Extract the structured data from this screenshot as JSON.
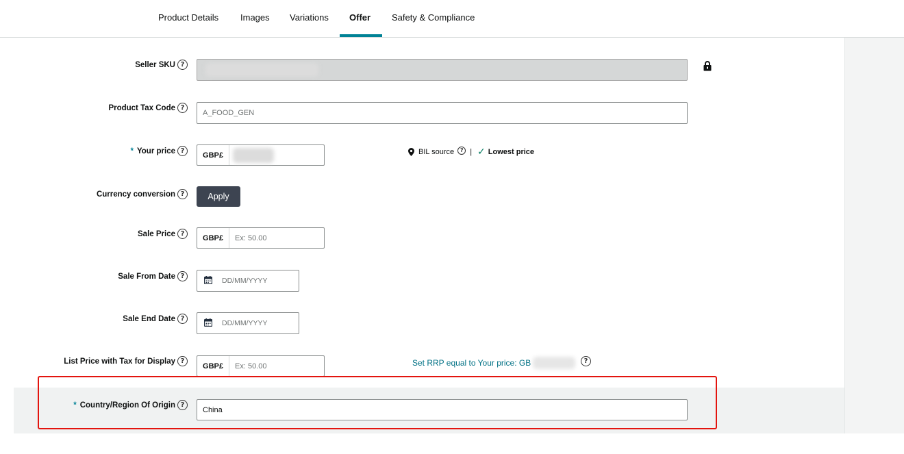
{
  "tabs": [
    {
      "label": "Product Details"
    },
    {
      "label": "Images"
    },
    {
      "label": "Variations"
    },
    {
      "label": "Offer"
    },
    {
      "label": "Safety & Compliance"
    }
  ],
  "active_tab": "Offer",
  "fields": {
    "seller_sku": {
      "label": "Seller SKU",
      "help": "?",
      "value": ""
    },
    "product_tax_code": {
      "label": "Product Tax Code",
      "help": "?",
      "value": "A_FOOD_GEN"
    },
    "your_price": {
      "required_mark": "*",
      "label": "Your price",
      "help": "?",
      "currency": "GBP£",
      "value": ""
    },
    "currency_conversion": {
      "label": "Currency conversion",
      "help": "?",
      "button": "Apply"
    },
    "sale_price": {
      "label": "Sale Price",
      "help": "?",
      "currency": "GBP£",
      "placeholder": "Ex: 50.00"
    },
    "sale_from_date": {
      "label": "Sale From Date",
      "help": "?",
      "placeholder": "DD/MM/YYYY"
    },
    "sale_end_date": {
      "label": "Sale End Date",
      "help": "?",
      "placeholder": "DD/MM/YYYY"
    },
    "list_price": {
      "label": "List Price with Tax for Display",
      "help": "?",
      "currency": "GBP£",
      "placeholder": "Ex: 50.00"
    },
    "country_of_origin": {
      "required_mark": "*",
      "label": "Country/Region Of Origin",
      "help": "?",
      "value": "China"
    }
  },
  "bil": {
    "source_label": "BIL source",
    "help": "?",
    "separator": "|",
    "check": "✓",
    "status": "Lowest price"
  },
  "rrp_link": {
    "text": "Set RRP equal to Your price: GB",
    "help": "?"
  },
  "colors": {
    "accent": "#008296",
    "link": "#007185",
    "button": "#3d4451",
    "highlight_border": "#e3140e"
  },
  "icons": [
    "help-icon",
    "lock-icon",
    "location-pin-icon",
    "checkmark-icon",
    "calendar-icon"
  ]
}
